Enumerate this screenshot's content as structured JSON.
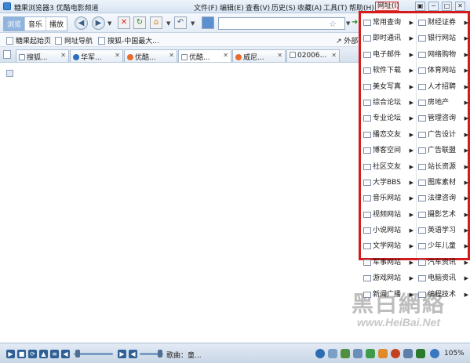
{
  "titlebar": {
    "app_title": "糖果浏览器3  优酷电影频道",
    "menus": [
      "文件(F)",
      "编辑(E)",
      "查看(V)",
      "历史(S)",
      "收藏(A)",
      "工具(T)",
      "帮助(H)",
      "网址(I)"
    ],
    "active_menu_index": 7,
    "window_buttons": [
      "▣",
      "─",
      "□",
      "✕"
    ]
  },
  "toolbar": {
    "mode_tabs": [
      "浏览",
      "音乐",
      "播放"
    ],
    "active_mode_index": 0,
    "back": "◀",
    "forward": "▶",
    "stop": "✕",
    "refresh": "↻",
    "home": "⌂",
    "undo": "↶",
    "address_value": "",
    "bookmark_star": "☆"
  },
  "favorites": {
    "items": [
      "糖果起始页",
      "网址导航",
      "搜狐-中国最大..."
    ],
    "outer_label": "外部"
  },
  "tabs": [
    "搜狐...",
    "华军...",
    "优酷...",
    "优酷...",
    "威尼...",
    "02006..."
  ],
  "dropdown": {
    "left_column": [
      "常用查询",
      "即时通讯",
      "电子邮件",
      "软件下载",
      "美女写真",
      "综合论坛",
      "专业论坛",
      "博客空间",
      "博客空间",
      "社区交友",
      "大学BBS",
      "音乐网站",
      "视频网站",
      "小说网站",
      "文学网站",
      "军事网站",
      "游戏网站",
      "新闻广播"
    ],
    "right_column": [
      "财经证券",
      "银行网站",
      "网络购物",
      "体育网站",
      "人才招聘",
      "房地产",
      "管理咨询",
      "广告设计",
      "广告联盟",
      "站长资源",
      "图库素材",
      "法律咨询",
      "摄影艺术",
      "英语学习",
      "少年儿童",
      "汽车资讯",
      "电脑资讯",
      "编程技术"
    ],
    "left_column_display": [
      "常用查询",
      "即时通讯",
      "电子邮件",
      "软件下载",
      "美女写真",
      "综合论坛",
      "专业论坛",
      "播恋交友",
      "博客空间",
      "社区交友",
      "大学BBS",
      "音乐网站",
      "视频网站",
      "小说网站",
      "文学网站",
      "军事网站",
      "游戏网站",
      "新闻广播"
    ]
  },
  "watermark": {
    "text": "黑白網絡",
    "url": "www.HeiBai.Net"
  },
  "statusbar": {
    "song_label": "歌曲：童...",
    "zoom_label": "105%",
    "volume_level": 0.85,
    "progress_level": 0.1
  },
  "colors": {
    "highlight_border": "#d51c1c",
    "toolbar_blue": "#8fb4de"
  }
}
